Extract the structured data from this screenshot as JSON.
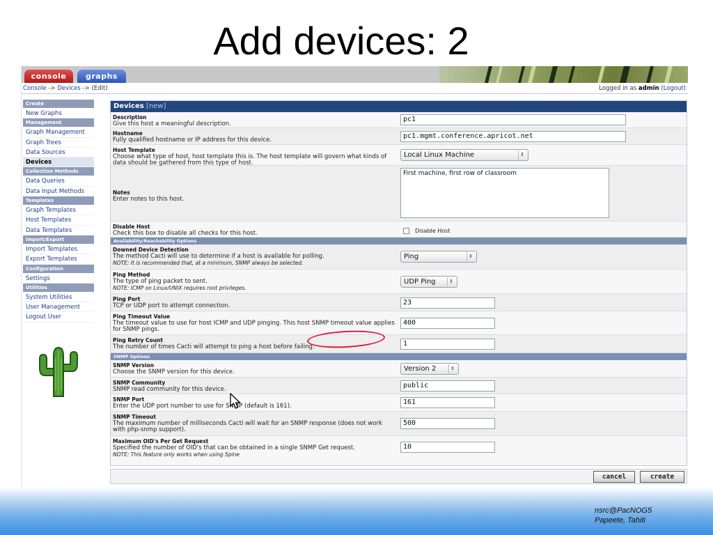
{
  "slide": {
    "title": "Add devices: 2",
    "footer_line1": "nsrc@PacNOG5",
    "footer_line2": "Papeete, Tahiti"
  },
  "tabs": {
    "console": "console",
    "graphs": "graphs"
  },
  "breadcrumb": {
    "console": "Console",
    "sep1": " -> ",
    "devices": "Devices",
    "sep2": " -> ",
    "edit": "(Edit)"
  },
  "login": {
    "prefix": "Logged in as ",
    "user": "admin",
    "logout": "(Logout)"
  },
  "sidebar": {
    "create": "Create",
    "new_graphs": "New Graphs",
    "management": "Management",
    "graph_management": "Graph Management",
    "graph_trees": "Graph Trees",
    "data_sources": "Data Sources",
    "devices": "Devices",
    "collection_methods": "Collection Methods",
    "data_queries": "Data Queries",
    "data_input_methods": "Data Input Methods",
    "templates": "Templates",
    "graph_templates": "Graph Templates",
    "host_templates": "Host Templates",
    "data_templates": "Data Templates",
    "import_export": "Import/Export",
    "import_templates": "Import Templates",
    "export_templates": "Export Templates",
    "configuration": "Configuration",
    "settings": "Settings",
    "utilities": "Utilities",
    "system_utilities": "System Utilities",
    "user_management": "User Management",
    "logout_user": "Logout User"
  },
  "form": {
    "header": "Devices",
    "header_tag": " [new]",
    "description": {
      "title": "Description",
      "desc": "Give this host a meaningful description.",
      "value": "pc1"
    },
    "hostname": {
      "title": "Hostname",
      "desc": "Fully qualified hostname or IP address for this device.",
      "value": "pc1.mgmt.conference.apricot.net"
    },
    "host_template": {
      "title": "Host Template",
      "desc": "Choose what type of host, host template this is. The host template will govern what kinds of data should be gathered from this type of host.",
      "value": "Local Linux Machine"
    },
    "notes": {
      "title": "Notes",
      "desc": "Enter notes to this host.",
      "value": "First machine, first row of classroom"
    },
    "disable_host": {
      "title": "Disable Host",
      "desc": "Check this box to disable all checks for this host.",
      "label": "Disable Host"
    },
    "section_availability": "Availability/Reachability Options",
    "downed_detection": {
      "title": "Downed Device Detection",
      "desc": "The method Cacti will use to determine if a host is available for polling.",
      "note": "NOTE: It is recommended that, at a minimum, SNMP always be selected.",
      "value": "Ping"
    },
    "ping_method": {
      "title": "Ping Method",
      "desc": "The type of ping packet to sent.",
      "note": "NOTE: ICMP on Linux/UNIX requires root privileges.",
      "value": "UDP Ping"
    },
    "ping_port": {
      "title": "Ping Port",
      "desc": "TCP or UDP port to attempt connection.",
      "value": "23"
    },
    "ping_timeout": {
      "title": "Ping Timeout Value",
      "desc": "The timeout value to use for host ICMP and UDP pinging. This host SNMP timeout value applies for SNMP pings.",
      "value": "400"
    },
    "ping_retry": {
      "title": "Ping Retry Count",
      "desc": "The number of times Cacti will attempt to ping a host before failing.",
      "value": "1"
    },
    "section_snmp": "SNMP Options",
    "snmp_version": {
      "title": "SNMP Version",
      "desc": "Choose the SNMP version for this device.",
      "value": "Version 2"
    },
    "snmp_community": {
      "title": "SNMP Community",
      "desc": "SNMP read community for this device.",
      "value": "public"
    },
    "snmp_port": {
      "title": "SNMP Port",
      "desc": "Enter the UDP port number to use for SNMP (default is 161).",
      "value": "161"
    },
    "snmp_timeout": {
      "title": "SNMP Timeout",
      "desc": "The maximum number of milliseconds Cacti will wait for an SNMP response (does not work with php-snmp support).",
      "value": "500"
    },
    "max_oids": {
      "title": "Maximum OID's Per Get Request",
      "desc": "Specified the number of OID's that can be obtained in a single SNMP Get request.",
      "note": "NOTE: This feature only works when using Spine",
      "value": "10"
    }
  },
  "buttons": {
    "cancel": "cancel",
    "create": "create"
  },
  "colors": {
    "header_blue": "#23467d",
    "section_blue": "#7e8fb4",
    "highlight_red": "#e0193d",
    "tab_red": "#b01818",
    "tab_blue": "#2b56b8"
  }
}
